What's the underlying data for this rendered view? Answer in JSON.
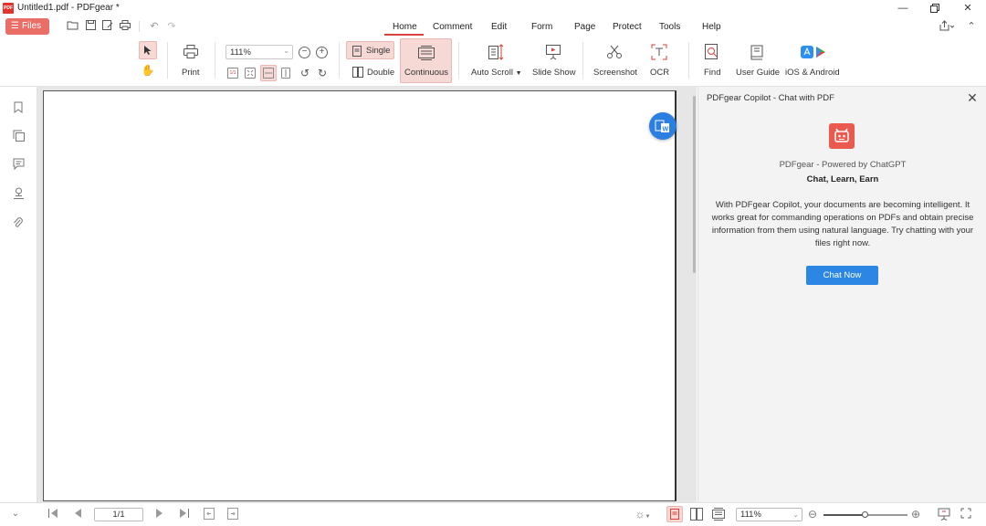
{
  "window": {
    "title": "Untitled1.pdf - PDFgear *",
    "logo_text": "PDF"
  },
  "menu": {
    "files_label": "Files",
    "tabs": [
      {
        "label": "Home",
        "active": true
      },
      {
        "label": "Comment"
      },
      {
        "label": "Edit"
      },
      {
        "label": "Form"
      },
      {
        "label": "Page"
      },
      {
        "label": "Protect"
      },
      {
        "label": "Tools"
      },
      {
        "label": "Help"
      }
    ]
  },
  "ribbon": {
    "print": "Print",
    "zoom_value": "111%",
    "single": "Single",
    "double": "Double",
    "continuous": "Continuous",
    "auto_scroll": "Auto Scroll",
    "slide_show": "Slide Show",
    "screenshot": "Screenshot",
    "ocr": "OCR",
    "find": "Find",
    "user_guide": "User Guide",
    "ios_android": "iOS & Android",
    "fit_small_label": "1/1"
  },
  "copilot": {
    "title": "PDFgear Copilot - Chat with PDF",
    "powered": "PDFgear - Powered by ChatGPT",
    "tagline": "Chat, Learn, Earn",
    "description": "With PDFgear Copilot, your documents are becoming intelligent. It works great for commanding operations on PDFs and obtain precise information from them using natural language. Try chatting with your files right now.",
    "chat_now": "Chat Now"
  },
  "status": {
    "page_indicator": "1/1",
    "zoom_value": "111%",
    "zoom_level": 0.5
  },
  "colors": {
    "accent": "#d9413a",
    "files_button": "#ea6e65",
    "chat_button": "#2b87e3",
    "fab": "#2b7fe0"
  }
}
